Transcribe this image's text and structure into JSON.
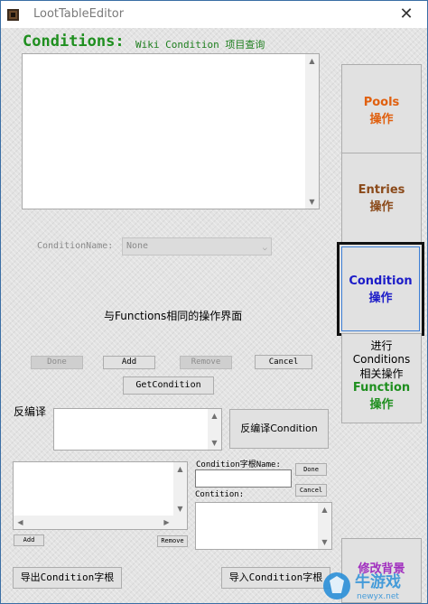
{
  "window": {
    "title": "LootTableEditor",
    "close_glyph": "✕"
  },
  "header": {
    "title": "Conditions:",
    "subtitle": "Wiki Condition 项目查询"
  },
  "condition_name": {
    "label": "ConditionName:",
    "selected": "None"
  },
  "notice": "与Functions相同的操作界面",
  "buttons": {
    "done": "Done",
    "add": "Add",
    "remove": "Remove",
    "cancel": "Cancel",
    "get_condition": "GetCondition",
    "decompile_condition": "反编译Condition",
    "small_done": "Done",
    "small_cancel": "Cancel",
    "list_add": "Add",
    "list_remove": "Remove",
    "export_root": "导出Condition字根",
    "import_root": "导入Condition字根"
  },
  "decompile": {
    "label": "反编译"
  },
  "root_form": {
    "name_label": "Condition字根Name:",
    "condition_label": "Contition:"
  },
  "sidebar": {
    "pools": {
      "line1": "Pools",
      "line2": "操作",
      "color": "#e0600f"
    },
    "entries": {
      "line1": "Entries",
      "line2": "操作",
      "color": "#8b4a1a"
    },
    "condition": {
      "line1": "Condition",
      "line2": "操作",
      "color": "#1c1cc8"
    },
    "note_line1": "进行Conditions",
    "note_line2": "相关操作",
    "function": {
      "line1": "Function",
      "line2": "操作",
      "color": "#1f8f1f"
    },
    "background": {
      "line1": "修改背景",
      "color": "#a12fbf"
    }
  },
  "watermark": {
    "line1": "牛游戏",
    "line2": "newyx.net"
  }
}
